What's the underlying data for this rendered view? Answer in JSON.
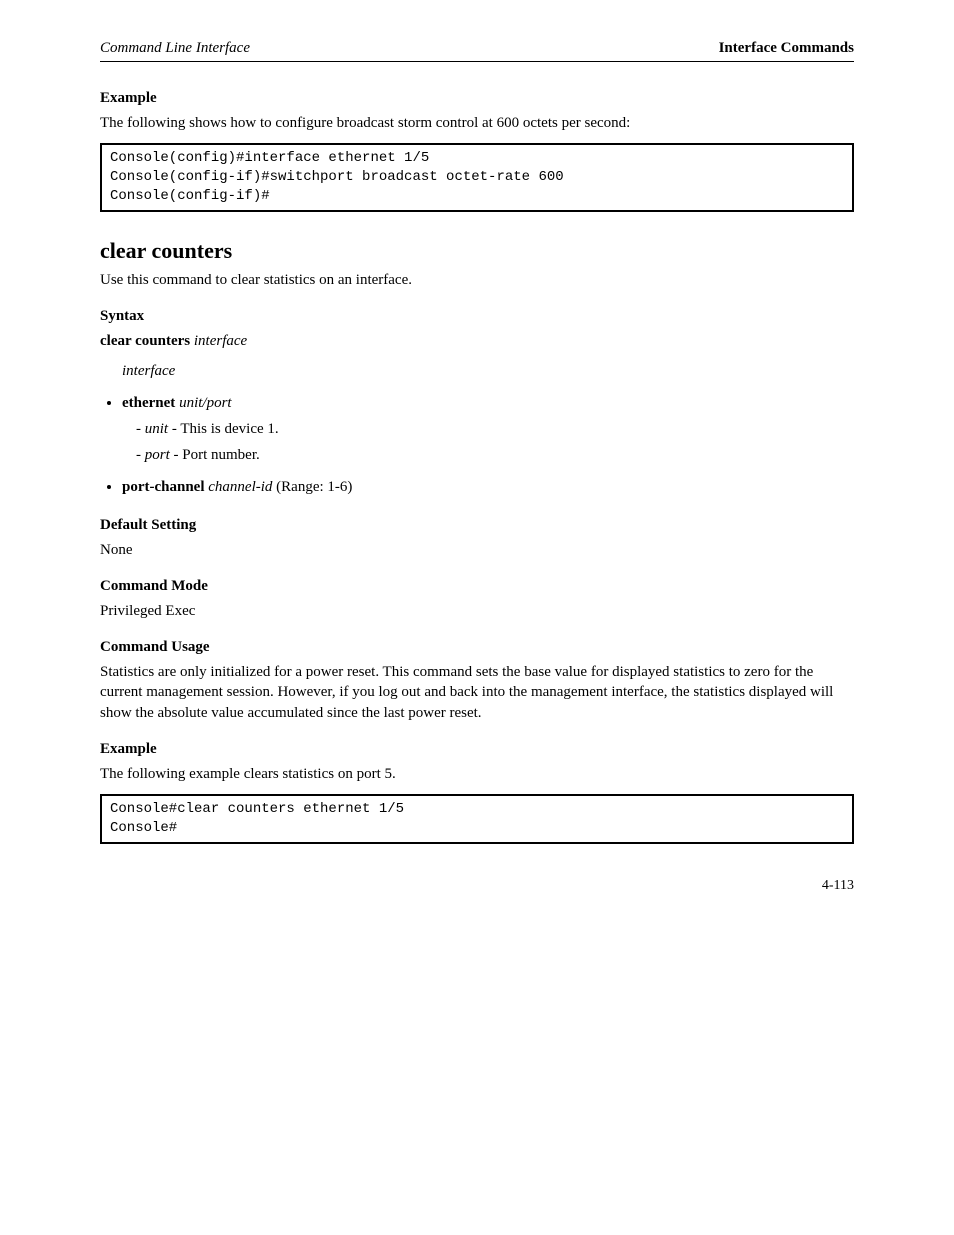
{
  "header": {
    "left": "Command Line Interface",
    "right": "Interface Commands"
  },
  "block1": {
    "example_label": "Example",
    "example_text": "The following shows how to configure broadcast storm control at 600 octets per second:",
    "code": "Console(config)#interface ethernet 1/5\nConsole(config-if)#switchport broadcast octet-rate 600\nConsole(config-if)#"
  },
  "cmd": {
    "title": "clear counters",
    "desc": "Use this command to clear statistics on an interface.",
    "syntax_label": "Syntax",
    "syntax_line": "clear counters",
    "syntax_arg": "interface",
    "interface_intro_italic": "interface",
    "bullets": [
      {
        "bold": "ethernet",
        "italic": "unit/port"
      },
      {
        "plain_italic": "unit",
        "rest": " - This is device 1."
      },
      {
        "plain_italic": "port",
        "rest": " - Port number."
      },
      {
        "bold": "port-channel",
        "italic": "channel-id",
        "rest": " (Range: 1-6)"
      }
    ],
    "default_label": "Default Setting",
    "default_text": "None",
    "mode_label": "Command Mode",
    "mode_text": "Privileged Exec",
    "usage_label": "Command Usage",
    "usage_text": "Statistics are only initialized for a power reset. This command sets the base value for displayed statistics to zero for the current management session. However, if you log out and back into the management interface, the statistics displayed will show the absolute value accumulated since the last power reset.",
    "example_label": "Example",
    "example_text": "The following example clears statistics on port 5.",
    "example_code": "Console#clear counters ethernet 1/5\nConsole#"
  },
  "footer": {
    "page_number": "4-113"
  }
}
